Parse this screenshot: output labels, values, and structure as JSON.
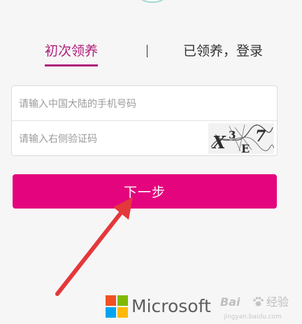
{
  "tabs": [
    {
      "label": "初次领养",
      "active": true
    },
    {
      "label": "已领养，登录",
      "active": false
    }
  ],
  "divider_text": "|",
  "form": {
    "phone_placeholder": "请输入中国大陆的手机号码",
    "captcha_placeholder": "请输入右侧验证码",
    "captcha_chars": [
      "X",
      "3",
      "E",
      "7"
    ]
  },
  "next_button": {
    "label": "下一步"
  },
  "footer": {
    "brand": "Microsoft"
  },
  "watermark": {
    "brand": "Bai",
    "product": "经验",
    "domain": "jingyan.baidu.com"
  },
  "colors": {
    "accent": "#e4047e",
    "tab_active": "#b01e7a",
    "tab_inactive": "#333333",
    "arrow": "#e5383b",
    "ms_red": "#f25022",
    "ms_green": "#7fba00",
    "ms_blue": "#00a4ef",
    "ms_yellow": "#ffb900"
  }
}
